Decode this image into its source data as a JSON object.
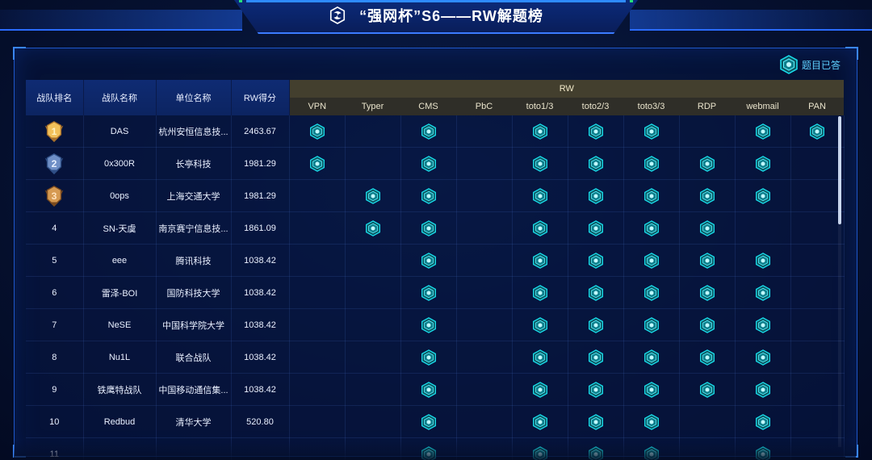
{
  "header": {
    "title": "“强网杯”S6——RW解题榜",
    "icon": "swirl-logo-icon"
  },
  "legend": {
    "label": "题目已答",
    "icon": "hex-solved-icon"
  },
  "columns": {
    "rank": "战队排名",
    "team": "战队名称",
    "org": "单位名称",
    "score": "RW得分",
    "group": "RW",
    "challenges": [
      "VPN",
      "Typer",
      "CMS",
      "PbC",
      "toto1/3",
      "toto2/3",
      "toto3/3",
      "RDP",
      "webmail",
      "PAN"
    ]
  },
  "colors": {
    "accent": "#2a6bff",
    "solved_hex": "#19c9d6",
    "rw_header": "#433f2e"
  },
  "rows": [
    {
      "rank": "1",
      "medal": "gold-medal-1-icon",
      "team": "DAS",
      "org": "杭州安恒信息技...",
      "score": "2463.67",
      "solved": [
        1,
        0,
        1,
        0,
        1,
        1,
        1,
        0,
        1,
        1
      ]
    },
    {
      "rank": "2",
      "medal": "silver-medal-2-icon",
      "team": "0x300R",
      "org": "长亭科技",
      "score": "1981.29",
      "solved": [
        1,
        0,
        1,
        0,
        1,
        1,
        1,
        1,
        1,
        0
      ]
    },
    {
      "rank": "3",
      "medal": "bronze-medal-3-icon",
      "team": "0ops",
      "org": "上海交通大学",
      "score": "1981.29",
      "solved": [
        0,
        1,
        1,
        0,
        1,
        1,
        1,
        1,
        1,
        0
      ]
    },
    {
      "rank": "4",
      "medal": "",
      "team": "SN-天虞",
      "org": "南京赛宁信息技...",
      "score": "1861.09",
      "solved": [
        0,
        1,
        1,
        0,
        1,
        1,
        1,
        1,
        0,
        0
      ]
    },
    {
      "rank": "5",
      "medal": "",
      "team": "eee",
      "org": "腾讯科技",
      "score": "1038.42",
      "solved": [
        0,
        0,
        1,
        0,
        1,
        1,
        1,
        1,
        1,
        0
      ]
    },
    {
      "rank": "6",
      "medal": "",
      "team": "雷泽-BOI",
      "org": "国防科技大学",
      "score": "1038.42",
      "solved": [
        0,
        0,
        1,
        0,
        1,
        1,
        1,
        1,
        1,
        0
      ]
    },
    {
      "rank": "7",
      "medal": "",
      "team": "NeSE",
      "org": "中国科学院大学",
      "score": "1038.42",
      "solved": [
        0,
        0,
        1,
        0,
        1,
        1,
        1,
        1,
        1,
        0
      ]
    },
    {
      "rank": "8",
      "medal": "",
      "team": "Nu1L",
      "org": "联合战队",
      "score": "1038.42",
      "solved": [
        0,
        0,
        1,
        0,
        1,
        1,
        1,
        1,
        1,
        0
      ]
    },
    {
      "rank": "9",
      "medal": "",
      "team": "铁鹰特战队",
      "org": "中国移动通信集...",
      "score": "1038.42",
      "solved": [
        0,
        0,
        1,
        0,
        1,
        1,
        1,
        1,
        1,
        0
      ]
    },
    {
      "rank": "10",
      "medal": "",
      "team": "Redbud",
      "org": "清华大学",
      "score": "520.80",
      "solved": [
        0,
        0,
        1,
        0,
        1,
        1,
        1,
        0,
        1,
        0
      ]
    },
    {
      "rank": "11",
      "medal": "",
      "team": "",
      "org": "",
      "score": "",
      "solved": [
        0,
        0,
        1,
        0,
        1,
        1,
        1,
        0,
        1,
        0
      ]
    }
  ]
}
